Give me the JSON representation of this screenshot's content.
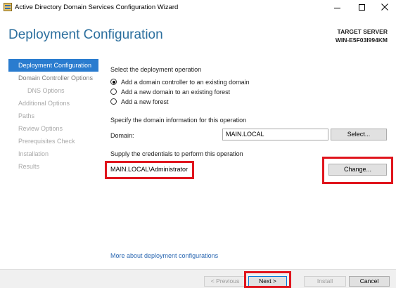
{
  "window": {
    "title": "Active Directory Domain Services Configuration Wizard",
    "icon": "ad-ds-wizard-icon"
  },
  "header": {
    "page_title": "Deployment Configuration",
    "target_label": "TARGET SERVER",
    "target_name": "WIN-E5F03I994KM"
  },
  "sidebar": {
    "items": [
      {
        "label": "Deployment Configuration",
        "state": "active"
      },
      {
        "label": "Domain Controller Options",
        "state": "enabled"
      },
      {
        "label": "DNS Options",
        "state": "disabled"
      },
      {
        "label": "Additional Options",
        "state": "disabled"
      },
      {
        "label": "Paths",
        "state": "disabled"
      },
      {
        "label": "Review Options",
        "state": "disabled"
      },
      {
        "label": "Prerequisites Check",
        "state": "disabled"
      },
      {
        "label": "Installation",
        "state": "disabled"
      },
      {
        "label": "Results",
        "state": "disabled"
      }
    ]
  },
  "main": {
    "operation_heading": "Select the deployment operation",
    "operations": [
      {
        "label": "Add a domain controller to an existing domain",
        "checked": true
      },
      {
        "label": "Add a new domain to an existing forest",
        "checked": false
      },
      {
        "label": "Add a new forest",
        "checked": false
      }
    ],
    "domain_heading": "Specify the domain information for this operation",
    "domain_label": "Domain:",
    "domain_value": "MAIN.LOCAL",
    "select_button": "Select...",
    "credentials_heading": "Supply the credentials to perform this operation",
    "credentials_value": "MAIN.LOCAL\\Administrator",
    "change_button": "Change...",
    "more_link": "More about deployment configurations"
  },
  "footer": {
    "previous": "< Previous",
    "next": "Next >",
    "install": "Install",
    "cancel": "Cancel"
  },
  "colors": {
    "accent": "#2a7ccf",
    "title": "#2c6f9e",
    "highlight": "#e0151d",
    "link": "#2a67b1"
  }
}
